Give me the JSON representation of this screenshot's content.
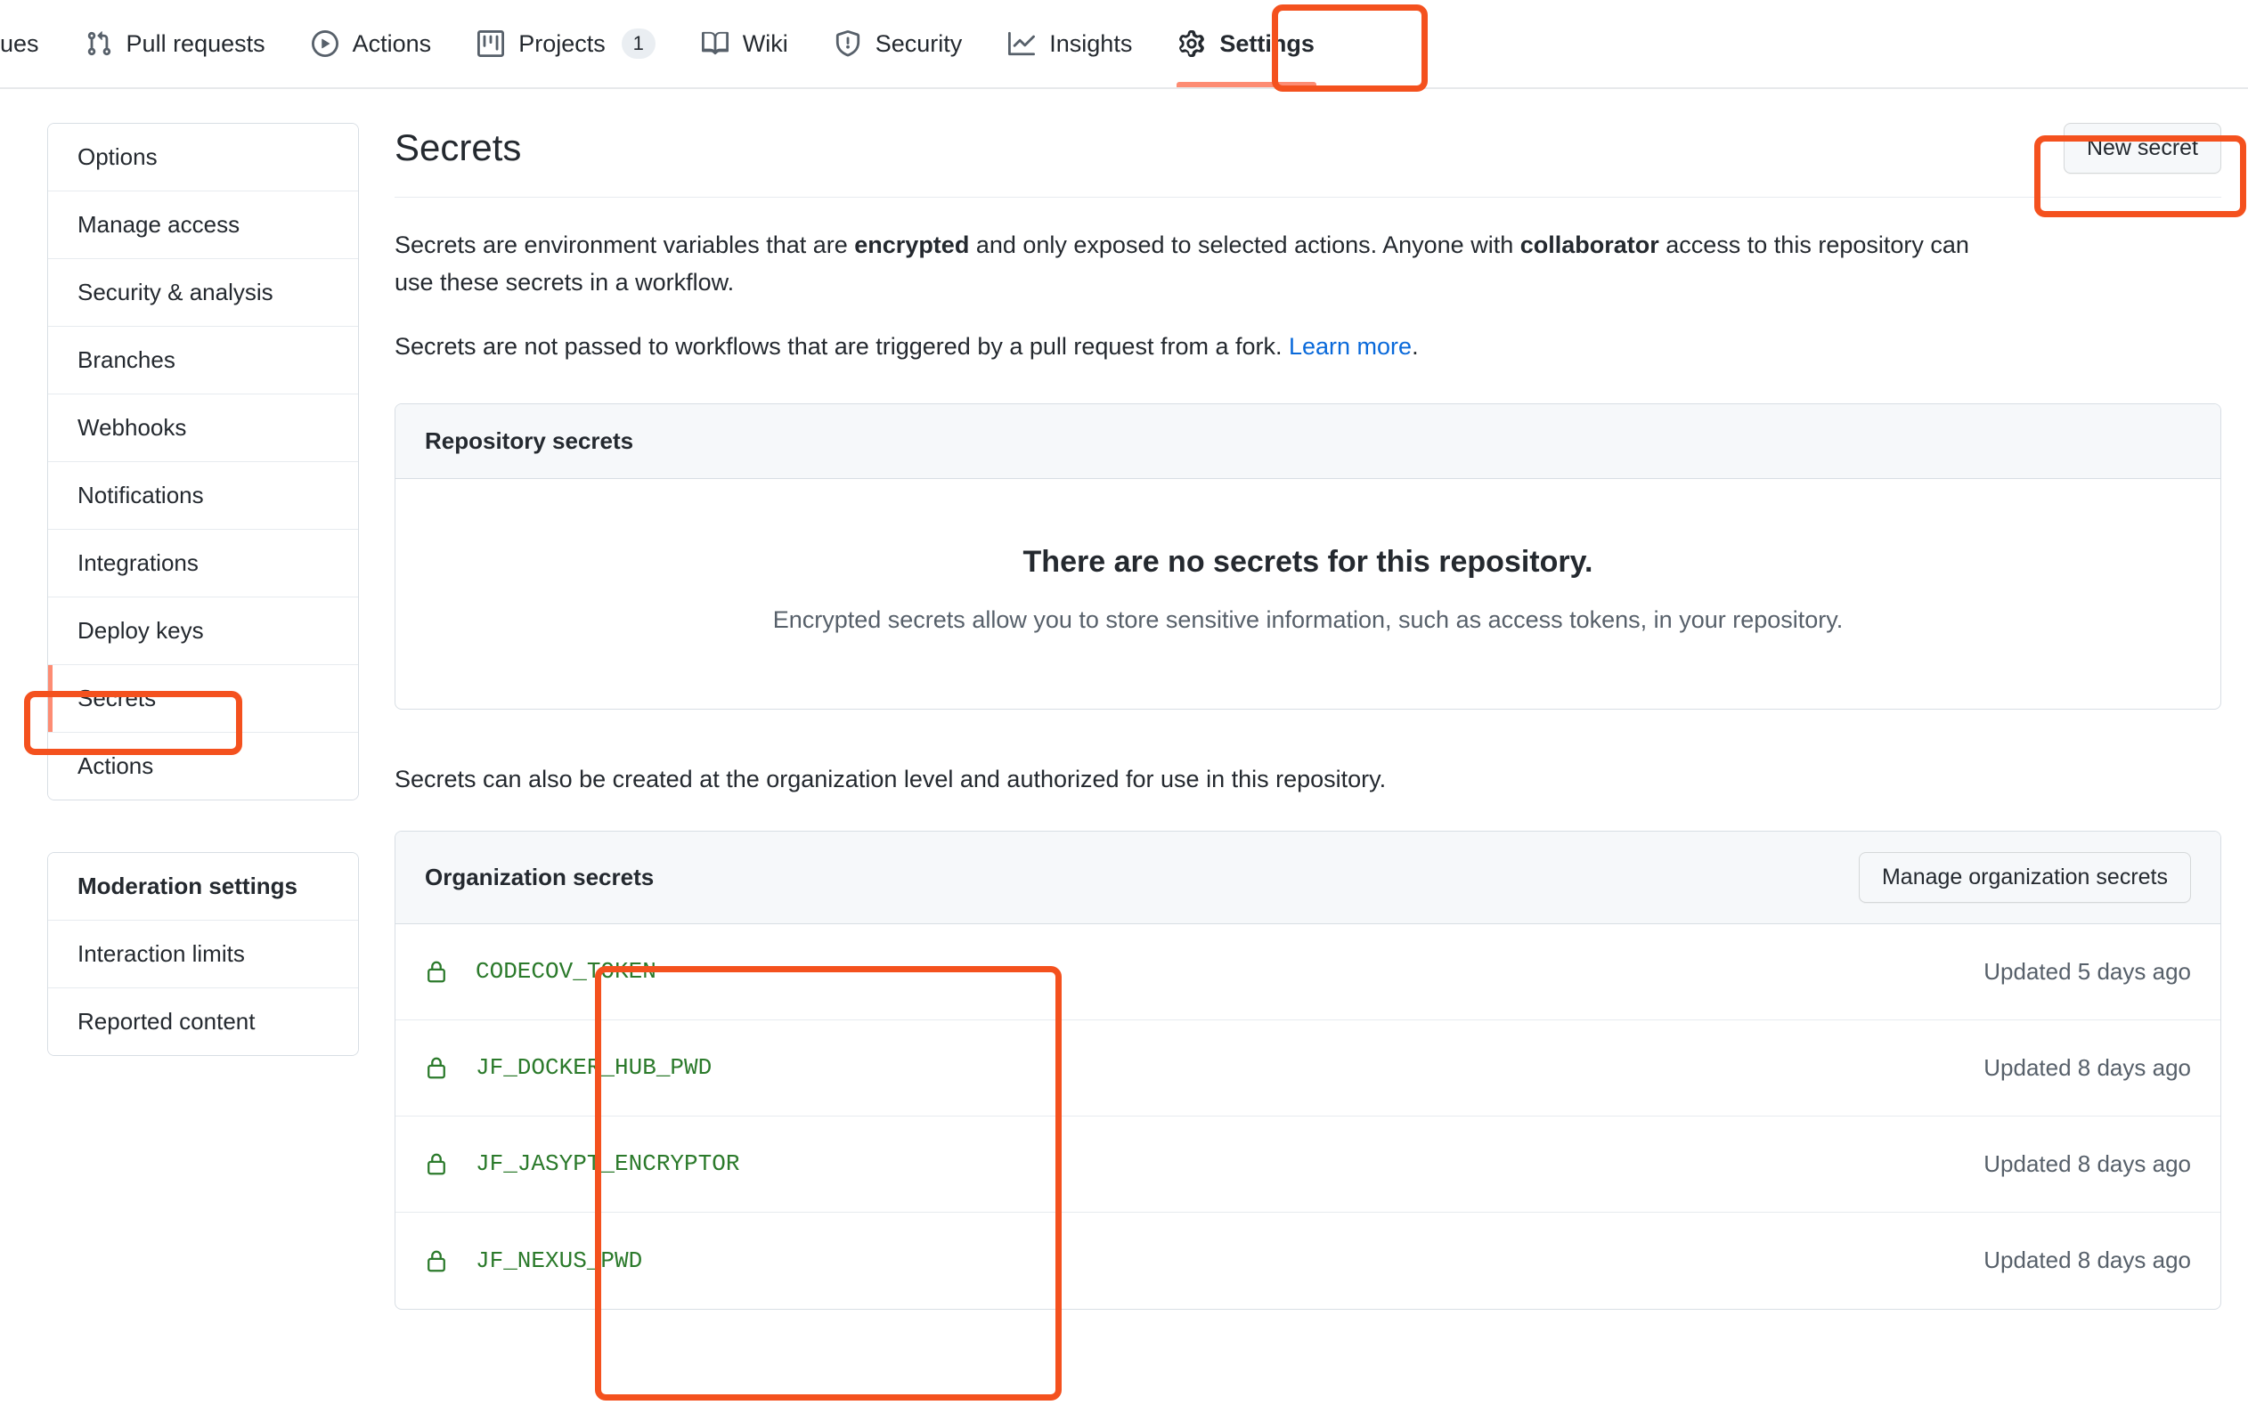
{
  "repo_nav": {
    "items": [
      {
        "label": "ues",
        "icon": "issues-icon",
        "partial": true,
        "selected": false,
        "counter": null
      },
      {
        "label": "Pull requests",
        "icon": "git-pull-request-icon",
        "partial": false,
        "selected": false,
        "counter": null
      },
      {
        "label": "Actions",
        "icon": "play-circle-icon",
        "partial": false,
        "selected": false,
        "counter": null
      },
      {
        "label": "Projects",
        "icon": "project-board-icon",
        "partial": false,
        "selected": false,
        "counter": "1"
      },
      {
        "label": "Wiki",
        "icon": "book-icon",
        "partial": false,
        "selected": false,
        "counter": null
      },
      {
        "label": "Security",
        "icon": "shield-alert-icon",
        "partial": false,
        "selected": false,
        "counter": null
      },
      {
        "label": "Insights",
        "icon": "graph-line-icon",
        "partial": false,
        "selected": false,
        "counter": null
      },
      {
        "label": "Settings",
        "icon": "gear-icon",
        "partial": false,
        "selected": true,
        "counter": null
      }
    ]
  },
  "sidebar": {
    "primary_menu": [
      {
        "label": "Options",
        "active": false,
        "heading": false
      },
      {
        "label": "Manage access",
        "active": false,
        "heading": false
      },
      {
        "label": "Security & analysis",
        "active": false,
        "heading": false
      },
      {
        "label": "Branches",
        "active": false,
        "heading": false
      },
      {
        "label": "Webhooks",
        "active": false,
        "heading": false
      },
      {
        "label": "Notifications",
        "active": false,
        "heading": false
      },
      {
        "label": "Integrations",
        "active": false,
        "heading": false
      },
      {
        "label": "Deploy keys",
        "active": false,
        "heading": false
      },
      {
        "label": "Secrets",
        "active": true,
        "heading": false
      },
      {
        "label": "Actions",
        "active": false,
        "heading": false
      }
    ],
    "moderation_menu": [
      {
        "label": "Moderation settings",
        "active": false,
        "heading": true
      },
      {
        "label": "Interaction limits",
        "active": false,
        "heading": false
      },
      {
        "label": "Reported content",
        "active": false,
        "heading": false
      }
    ]
  },
  "main": {
    "title": "Secrets",
    "new_secret_label": "New secret",
    "description_1": {
      "part1": "Secrets are environment variables that are ",
      "bold1": "encrypted",
      "part2": " and only exposed to selected actions. Anyone with ",
      "bold2": "collaborator",
      "part3": " access to this repository can use these secrets in a workflow."
    },
    "description_2": {
      "part1": "Secrets are not passed to workflows that are triggered by a pull request from a fork. ",
      "link": "Learn more",
      "part2": "."
    },
    "repository_secrets": {
      "header": "Repository secrets",
      "blank_title": "There are no secrets for this repository.",
      "blank_subtitle": "Encrypted secrets allow you to store sensitive information, such as access tokens, in your repository."
    },
    "org_note": "Secrets can also be created at the organization level and authorized for use in this repository.",
    "organization_secrets": {
      "header": "Organization secrets",
      "manage_button": "Manage organization secrets",
      "rows": [
        {
          "name": "CODECOV_TOKEN",
          "updated": "Updated 5 days ago"
        },
        {
          "name": "JF_DOCKER_HUB_PWD",
          "updated": "Updated 8 days ago"
        },
        {
          "name": "JF_JASYPT_ENCRYPTOR",
          "updated": "Updated 8 days ago"
        },
        {
          "name": "JF_NEXUS_PWD",
          "updated": "Updated 8 days ago"
        }
      ]
    }
  },
  "annotations": {
    "color": "#f4511e",
    "targets": [
      "settings-tab",
      "new-secret-button",
      "sidebar-secrets-item",
      "organization-secrets-names"
    ]
  }
}
